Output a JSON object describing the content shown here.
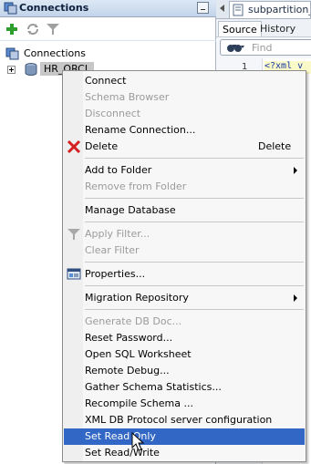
{
  "connections_panel": {
    "title": "Connections",
    "tree": {
      "root_label": "Connections",
      "child_label": "HR_ORCL"
    }
  },
  "editor": {
    "tab_label": "subpartition_t",
    "subtabs": [
      "Source",
      "History"
    ],
    "find_placeholder": "Find",
    "line_number": "1",
    "code_text": "<?xml v"
  },
  "context_menu": {
    "items": [
      {
        "label": "Connect",
        "enabled": true
      },
      {
        "label": "Schema Browser",
        "enabled": false
      },
      {
        "label": "Disconnect",
        "enabled": false
      },
      {
        "label": "Rename Connection...",
        "enabled": true
      },
      {
        "label": "Delete",
        "enabled": true,
        "shortcut": "Delete",
        "icon": "red-x-icon"
      },
      {
        "label": "Add to Folder",
        "enabled": true,
        "submenu": true
      },
      {
        "label": "Remove from Folder",
        "enabled": false
      },
      {
        "label": "Manage Database",
        "enabled": true
      },
      {
        "label": "Apply Filter...",
        "enabled": false,
        "icon": "filter-icon"
      },
      {
        "label": "Clear Filter",
        "enabled": false
      },
      {
        "label": "Properties...",
        "enabled": true,
        "icon": "properties-icon"
      },
      {
        "label": "Migration Repository",
        "enabled": true,
        "submenu": true
      },
      {
        "label": "Generate DB Doc...",
        "enabled": false
      },
      {
        "label": "Reset Password...",
        "enabled": true
      },
      {
        "label": "Open SQL Worksheet",
        "enabled": true
      },
      {
        "label": "Remote Debug...",
        "enabled": true
      },
      {
        "label": "Gather Schema Statistics...",
        "enabled": true
      },
      {
        "label": "Recompile Schema ...",
        "enabled": true
      },
      {
        "label": "XML DB Protocol server configuration",
        "enabled": true
      },
      {
        "label": "Set Read Only",
        "enabled": true,
        "highlighted": true
      },
      {
        "label": "Set Read/Write",
        "enabled": true
      }
    ]
  },
  "colors": {
    "menu_highlight": "#3267c6",
    "disabled_text": "#9b9b9b",
    "selection_bg": "#c7c7c7",
    "panel_header": "#c2d4ea"
  }
}
